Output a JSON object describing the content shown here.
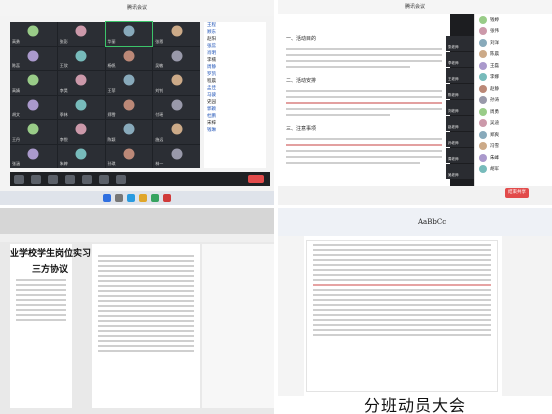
{
  "q1": {
    "window_title": "腾讯会议",
    "participants": [
      "高勇",
      "张彭",
      "华丽",
      "张恩",
      "陈蕊",
      "王欣",
      "杨帆",
      "吴敏",
      "高婧",
      "李昊",
      "王菲",
      "刘钊",
      "胡文",
      "季林",
      "郑雪",
      "付瑶",
      "王丹",
      "李悦",
      "陈颖",
      "施远",
      "张涵",
      "朱婷",
      "孙琪",
      "林一"
    ],
    "side_list": [
      "王程",
      "顾东",
      "赵阳",
      "张蕊",
      "肖明",
      "李楠",
      "周静",
      "罗凯",
      "程晨",
      "孟佳",
      "马骏",
      "史园",
      "郭颖",
      "杜鹏",
      "宋梓",
      "钱琳"
    ]
  },
  "q2": {
    "window_title": "腾讯会议",
    "doc_lines": [
      "一、活动目的",
      "二、活动安排",
      "三、注意事项"
    ],
    "cameras": [
      "张老师",
      "李老师",
      "王老师",
      "陈老师",
      "刘老师",
      "赵老师",
      "孙老师",
      "周老师",
      "吴老师"
    ],
    "members": [
      "钱婷",
      "张伟",
      "刘洋",
      "陈晨",
      "王磊",
      "李娜",
      "赵静",
      "孙涛",
      "周勇",
      "吴迪",
      "郑爽",
      "冯雪",
      "朱峰",
      "胡军"
    ],
    "share_label": "结束共享"
  },
  "q3": {
    "doc_title": [
      "业学校学生岗位实习",
      "三方协议"
    ]
  },
  "q4": {
    "brand": "AaBbCc",
    "caption": "分班动员大会"
  }
}
